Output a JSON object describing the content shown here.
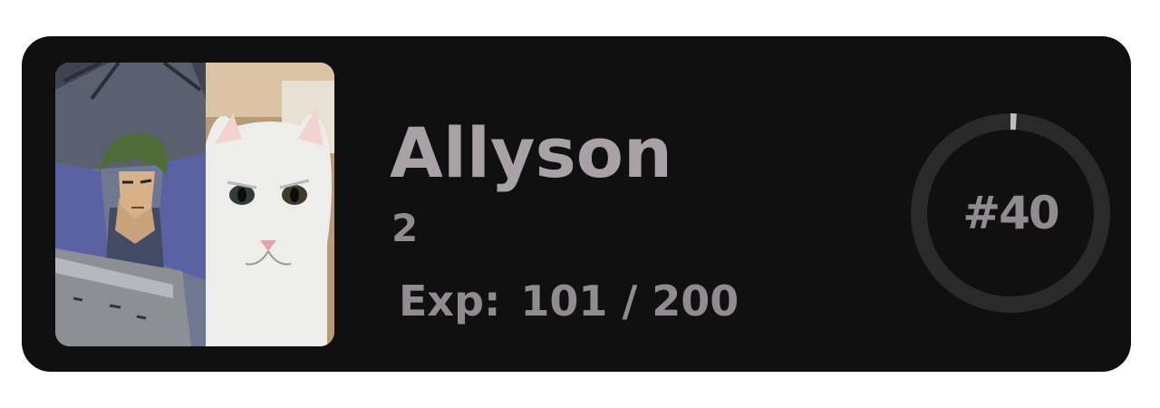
{
  "profile": {
    "name": "Allyson",
    "level": "2",
    "exp_label": "Exp:",
    "exp_value": "101 / 200",
    "exp_fraction": 0.505,
    "rank": "#40",
    "rank_progress_fraction": 0.01,
    "avatar_icon": "composite-avatar-anime-character-and-cat"
  },
  "colors": {
    "card_background": "#101010",
    "text_primary": "#a8a2a6",
    "text_secondary": "#8f8b8e",
    "ring_track": "#2a2a2a",
    "ring_progress": "#bdbdbd"
  }
}
